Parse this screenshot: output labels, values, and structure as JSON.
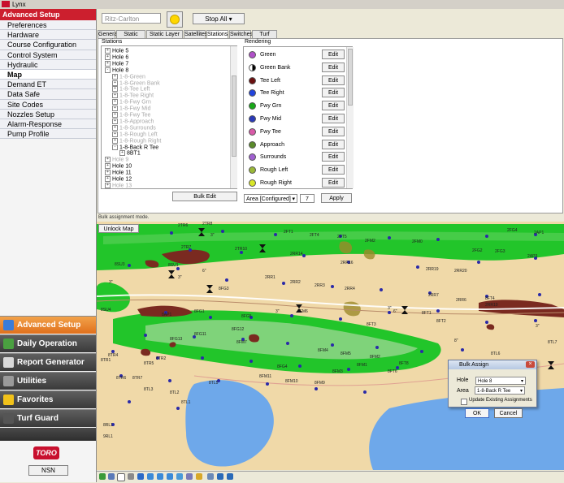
{
  "window": {
    "title": "Lynx"
  },
  "left_panel": {
    "header": "Advanced Setup",
    "menu": [
      "Preferences",
      "Hardware",
      "Course Configuration",
      "Control System",
      "Hydraulic",
      "Map",
      "Demand ET",
      "Data Safe",
      "Site Codes",
      "Nozzles Setup",
      "Alarm-Response",
      "Pump Profile"
    ],
    "selected": "Map",
    "nav": [
      "Advanced Setup",
      "Daily Operation",
      "Report Generator",
      "Utilities",
      "Favorites",
      "Turf Guard"
    ],
    "brand": "TORO",
    "nsn_label": "NSN"
  },
  "toolbar": {
    "course": "Ritz-Carlton",
    "stop_all_label": "Stop All"
  },
  "tabs": [
    "General",
    "Static Layers",
    "Static Layer Info",
    "Satellites",
    "Stations",
    "Switches",
    "Turf Guard"
  ],
  "active_tab": "Stations",
  "stations": {
    "label": "Stations",
    "tree": [
      {
        "text": "Hole 5",
        "level": 0,
        "dim": false,
        "exp": "+"
      },
      {
        "text": "Hole 6",
        "level": 0,
        "dim": false,
        "exp": "+"
      },
      {
        "text": "Hole 7",
        "level": 0,
        "dim": false,
        "exp": "+"
      },
      {
        "text": "Hole 8",
        "level": 0,
        "dim": false,
        "exp": "-"
      },
      {
        "text": "1-8-Green",
        "level": 1,
        "dim": true,
        "exp": "+"
      },
      {
        "text": "1-8-Green Bank",
        "level": 1,
        "dim": true,
        "exp": "+"
      },
      {
        "text": "1-8-Tee Left",
        "level": 1,
        "dim": true,
        "exp": "+"
      },
      {
        "text": "1-8-Tee Right",
        "level": 1,
        "dim": true,
        "exp": "+"
      },
      {
        "text": "1-8-Fwy Grn",
        "level": 1,
        "dim": true,
        "exp": "+"
      },
      {
        "text": "1-8-Fwy Mid",
        "level": 1,
        "dim": true,
        "exp": "+"
      },
      {
        "text": "1-8-Fwy Tee",
        "level": 1,
        "dim": true,
        "exp": "+"
      },
      {
        "text": "1-8-Approach",
        "level": 1,
        "dim": true,
        "exp": "+"
      },
      {
        "text": "1-8-Surrounds",
        "level": 1,
        "dim": true,
        "exp": "+"
      },
      {
        "text": "1-8-Rough Left",
        "level": 1,
        "dim": true,
        "exp": "+"
      },
      {
        "text": "1-8-Rough Right",
        "level": 1,
        "dim": true,
        "exp": "+"
      },
      {
        "text": "1-8-Back R Tee",
        "level": 1,
        "dim": false,
        "exp": "-"
      },
      {
        "text": "8BT1",
        "level": 2,
        "dim": false,
        "exp": "+"
      },
      {
        "text": "Hole 9",
        "level": 0,
        "dim": true,
        "exp": "+"
      },
      {
        "text": "Hole 10",
        "level": 0,
        "dim": false,
        "exp": "+"
      },
      {
        "text": "Hole 11",
        "level": 0,
        "dim": false,
        "exp": "+"
      },
      {
        "text": "Hole 12",
        "level": 0,
        "dim": false,
        "exp": "+"
      },
      {
        "text": "Hole 13",
        "level": 0,
        "dim": true,
        "exp": "+"
      }
    ],
    "bulk_edit_label": "Bulk Edit"
  },
  "rendering": {
    "label": "Rendering",
    "items": [
      {
        "name": "Green",
        "color": "#b050c8",
        "half": false
      },
      {
        "name": "Green Bank",
        "color": "#000000",
        "half": true
      },
      {
        "name": "Tee Left",
        "color": "#6a1010",
        "half": false
      },
      {
        "name": "Tee Right",
        "color": "#2244dd",
        "half": false
      },
      {
        "name": "Fwy Grn",
        "color": "#18a818",
        "half": false
      },
      {
        "name": "Fwy Mid",
        "color": "#2a3ab8",
        "half": false
      },
      {
        "name": "Fwy Tee",
        "color": "#d85aa8",
        "half": false
      },
      {
        "name": "Approach",
        "color": "#5a8a2a",
        "half": false
      },
      {
        "name": "Surrounds",
        "color": "#a060d0",
        "half": false
      },
      {
        "name": "Rough Left",
        "color": "#9ab838",
        "half": false
      },
      {
        "name": "Rough Right",
        "color": "#d8e628",
        "half": false
      }
    ],
    "edit_label": "Edit",
    "area_select": "Area [Configured]",
    "area_count": "7",
    "apply_label": "Apply"
  },
  "map": {
    "mode_text": "Bulk assignment mode.",
    "unlock_label": "Unlock Map",
    "labels": [
      "2TR6",
      "2TR8",
      "2FT1",
      "2FT4",
      "2FT5",
      "2FM2",
      "2FM0",
      "2FG4",
      "2AP1",
      "2TR7",
      "2TR10",
      "2RR14",
      "2RR16",
      "2RR19",
      "2RR20",
      "2FG3",
      "2FG2",
      "2AP3",
      "8SU3",
      "8SU1",
      "2RR1",
      "2RR2",
      "2RR3",
      "2RR4",
      "2RR7",
      "2RR6",
      "2RR10",
      "8FT4",
      "8AP1",
      "8SU4",
      "8FG1",
      "8FG3",
      "8FG5",
      "8FM6",
      "8FT3",
      "8FT1",
      "8FT2",
      "8TL7",
      "8TL6",
      "8FG11",
      "8FG13",
      "8FG12",
      "8FM7",
      "8FM4",
      "8FM5",
      "8FM2",
      "8FM1",
      "8FT8",
      "8FT6",
      "8TR4",
      "8TR2",
      "8TR1",
      "8TR6",
      "8TR7",
      "8TR5",
      "8TL5",
      "8TL3",
      "8TL2",
      "8TL1",
      "8FG4",
      "8FM11",
      "8FM10",
      "8FM9",
      "8FM3",
      "8RL1",
      "9RL1",
      "3\"",
      "3\"",
      "3\"",
      "3\"",
      "3\"",
      "6\"",
      "8\"",
      "6\"",
      "3\""
    ]
  },
  "dialog": {
    "title": "Bulk Assign",
    "hole_label": "Hole",
    "hole_value": "Hole 8",
    "area_label": "Area",
    "area_value": "1-8-Back R Tee",
    "checkbox_label": "Update Existing Assignments",
    "ok_label": "OK",
    "cancel_label": "Cancel"
  },
  "colors": {
    "red_header": "#cc1f2e",
    "orange_active": "#e9842e",
    "bright_green": "#22c52a",
    "fairway_green": "#7fd37a",
    "water": "#6ea8ea",
    "sand": "#f0d9a8"
  }
}
